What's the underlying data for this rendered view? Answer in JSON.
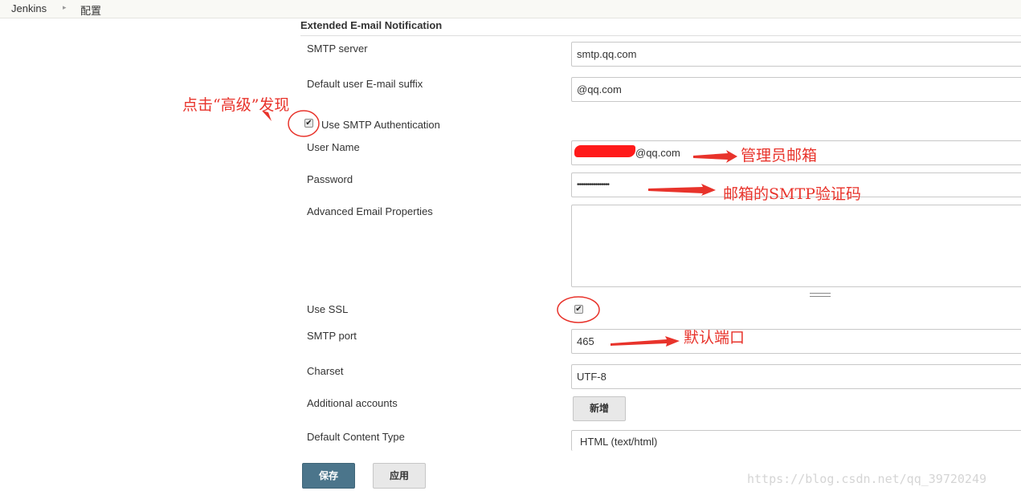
{
  "breadcrumb": {
    "items": [
      "Jenkins",
      "配置"
    ]
  },
  "section": {
    "title": "Extended E-mail Notification"
  },
  "fields": {
    "smtp_server": {
      "label": "SMTP server",
      "value": "smtp.qq.com"
    },
    "default_suffix": {
      "label": "Default user E-mail suffix",
      "value": "@qq.com"
    },
    "use_smtp_auth": {
      "label": "Use SMTP Authentication",
      "checked": true
    },
    "user_name": {
      "label": "User Name",
      "value": "@qq.com"
    },
    "password": {
      "label": "Password",
      "value": "••••••••••••••••"
    },
    "advanced_props": {
      "label": "Advanced Email Properties",
      "value": ""
    },
    "use_ssl": {
      "label": "Use SSL",
      "checked": true
    },
    "smtp_port": {
      "label": "SMTP port",
      "value": "465"
    },
    "charset": {
      "label": "Charset",
      "value": "UTF-8"
    },
    "additional_accounts": {
      "label": "Additional accounts",
      "button": "新增"
    },
    "default_content_type": {
      "label": "Default Content Type",
      "value": "HTML (text/html)"
    }
  },
  "buttons": {
    "save": "保存",
    "apply": "应用"
  },
  "annotations": {
    "advanced": "点击“高级”发现",
    "admin_email": "管理员邮箱",
    "smtp_code": "邮箱的SMTP验证码",
    "default_port": "默认端口",
    "color": "#e8332b"
  },
  "watermark": "https://blog.csdn.net/qq_39720249",
  "icons": {
    "breadcrumb_separator": "triangle-right-icon",
    "check": "check-icon"
  }
}
